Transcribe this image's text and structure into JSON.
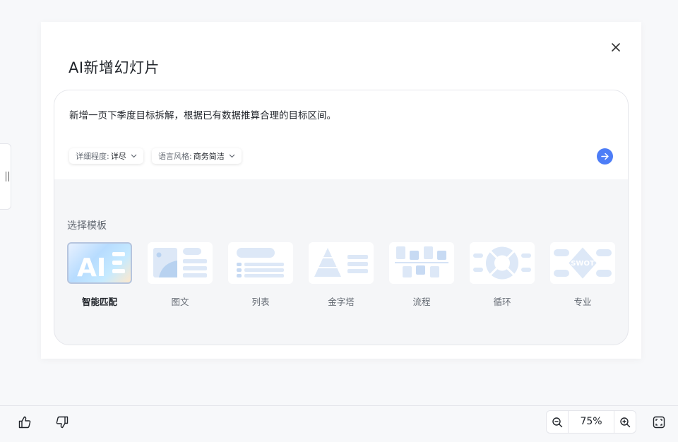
{
  "dialog": {
    "title": "AI新增幻灯片",
    "prompt": "新增一页下季度目标拆解，根据已有数据推算合理的目标区间。",
    "options": [
      {
        "key": "详细程度:",
        "value": "详尽"
      },
      {
        "key": "语言风格:",
        "value": "商务简洁"
      }
    ],
    "section_label": "选择模板",
    "templates": [
      {
        "label": "智能匹配",
        "selected": true,
        "thumb_text": "AI"
      },
      {
        "label": "图文",
        "selected": false
      },
      {
        "label": "列表",
        "selected": false
      },
      {
        "label": "金字塔",
        "selected": false
      },
      {
        "label": "流程",
        "selected": false
      },
      {
        "label": "循环",
        "selected": false
      },
      {
        "label": "专业",
        "selected": false,
        "thumb_text": "SWOT"
      }
    ]
  },
  "footer": {
    "zoom": "75%"
  },
  "colors": {
    "accent": "#4d7df7",
    "thumb_shape": "#dde8f7",
    "text_secondary": "#646a73"
  },
  "icons": [
    "close-icon",
    "chevron-down-icon",
    "arrow-right-icon",
    "thumbs-up-icon",
    "thumbs-down-icon",
    "zoom-out-icon",
    "zoom-in-icon",
    "fit-screen-icon",
    "drag-handle-icon"
  ]
}
